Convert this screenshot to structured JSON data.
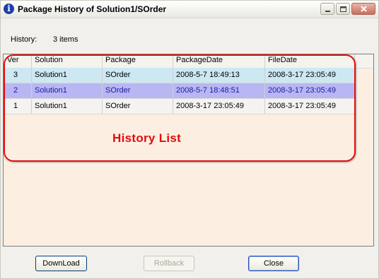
{
  "window": {
    "title": "Package History of Solution1/SOrder"
  },
  "history": {
    "label": "History:",
    "count": "3 items"
  },
  "table": {
    "columns": [
      "Ver",
      "Solution",
      "Package",
      "PackageDate",
      "FileDate"
    ],
    "rows": [
      {
        "ver": "3",
        "solution": "Solution1",
        "package": "SOrder",
        "package_date": "2008-5-7 18:49:13",
        "file_date": "2008-3-17 23:05:49"
      },
      {
        "ver": "2",
        "solution": "Solution1",
        "package": "SOrder",
        "package_date": "2008-5-7 18:48:51",
        "file_date": "2008-3-17 23:05:49"
      },
      {
        "ver": "1",
        "solution": "Solution1",
        "package": "SOrder",
        "package_date": "2008-3-17 23:05:49",
        "file_date": "2008-3-17 23:05:49"
      }
    ]
  },
  "annotation": {
    "label": "History List",
    "color": "#e20d0d"
  },
  "buttons": {
    "download": "DownLoad",
    "rollback": "Rollback",
    "close": "Close"
  },
  "colors": {
    "row_highlight": "#cce8f3",
    "row_selected": "#b9b6f4",
    "list_background": "#fcefe2"
  }
}
